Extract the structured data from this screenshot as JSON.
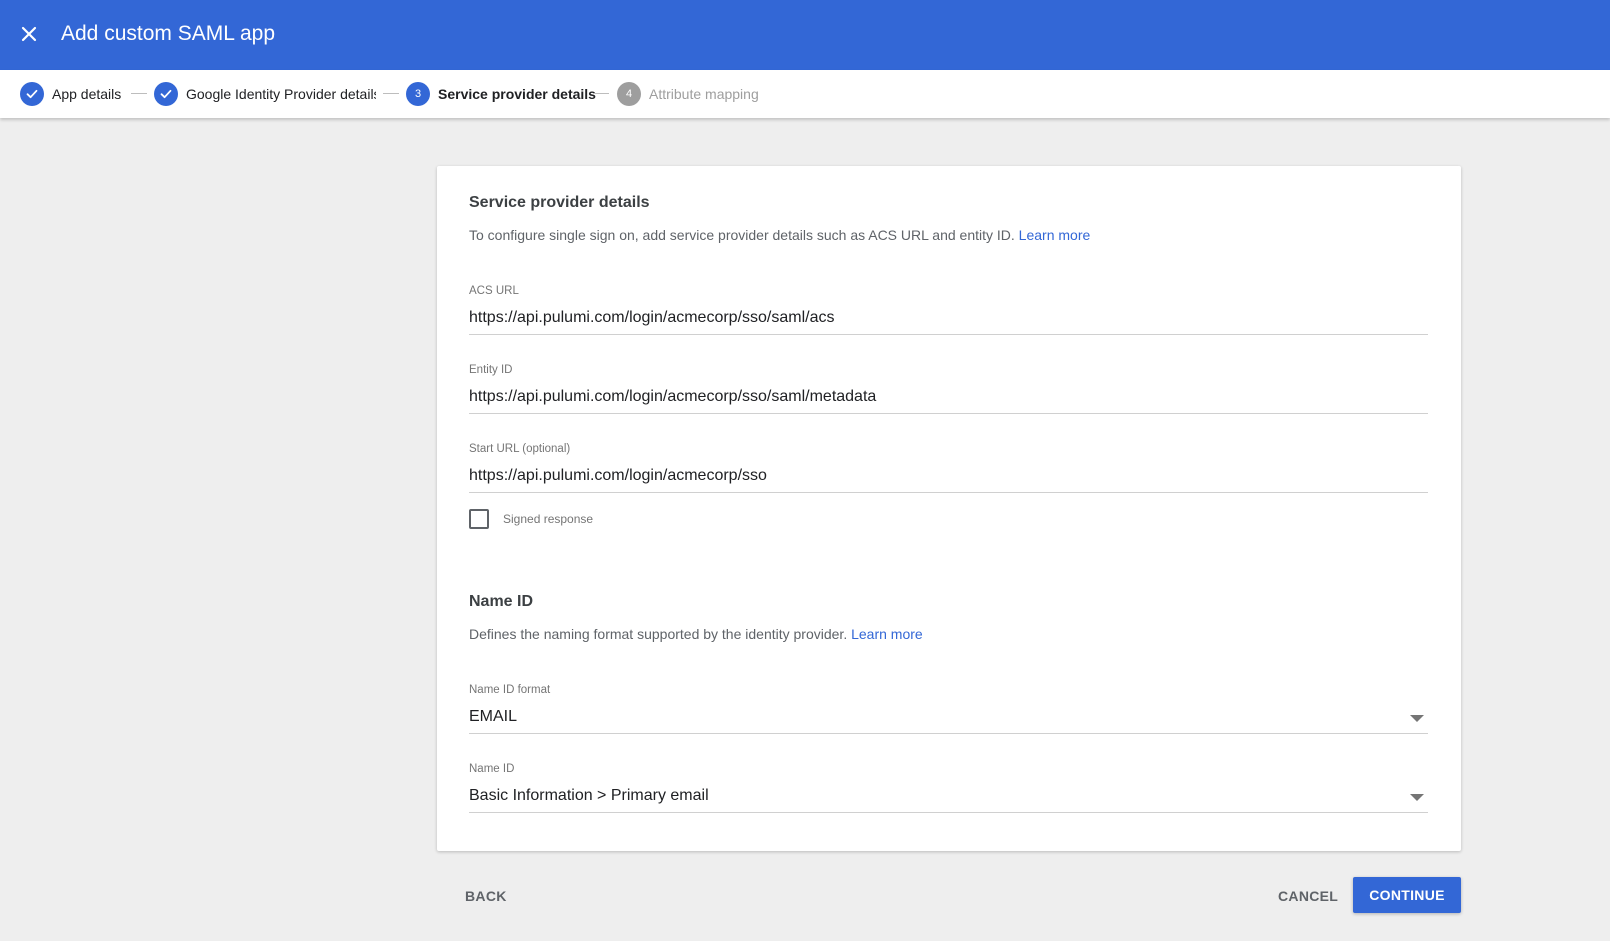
{
  "header": {
    "title": "Add custom SAML app",
    "close_icon": "close-icon"
  },
  "stepper": {
    "steps": [
      {
        "number": "1",
        "label": "App details",
        "state": "done"
      },
      {
        "number": "2",
        "label": "Google Identity Provider details",
        "state": "done"
      },
      {
        "number": "3",
        "label": "Service provider details",
        "state": "active"
      },
      {
        "number": "4",
        "label": "Attribute mapping",
        "state": "pending"
      }
    ]
  },
  "service_provider": {
    "title": "Service provider details",
    "description": "To configure single sign on, add service provider details such as ACS URL and entity ID.",
    "learn_more": "Learn more",
    "acs_url": {
      "label": "ACS URL",
      "value": "https://api.pulumi.com/login/acmecorp/sso/saml/acs"
    },
    "entity_id": {
      "label": "Entity ID",
      "value": "https://api.pulumi.com/login/acmecorp/sso/saml/metadata"
    },
    "start_url": {
      "label": "Start URL (optional)",
      "value": "https://api.pulumi.com/login/acmecorp/sso"
    },
    "signed_response": {
      "label": "Signed response",
      "checked": false
    }
  },
  "name_id": {
    "title": "Name ID",
    "description": "Defines the naming format supported by the identity provider.",
    "learn_more": "Learn more",
    "format": {
      "label": "Name ID format",
      "value": "EMAIL"
    },
    "name_id_field": {
      "label": "Name ID",
      "value": "Basic Information > Primary email"
    }
  },
  "footer": {
    "back_label": "BACK",
    "cancel_label": "CANCEL",
    "continue_label": "CONTINUE"
  },
  "colors": {
    "primary": "#3367d6",
    "pending": "#9e9e9e",
    "background": "#eeeeee"
  }
}
